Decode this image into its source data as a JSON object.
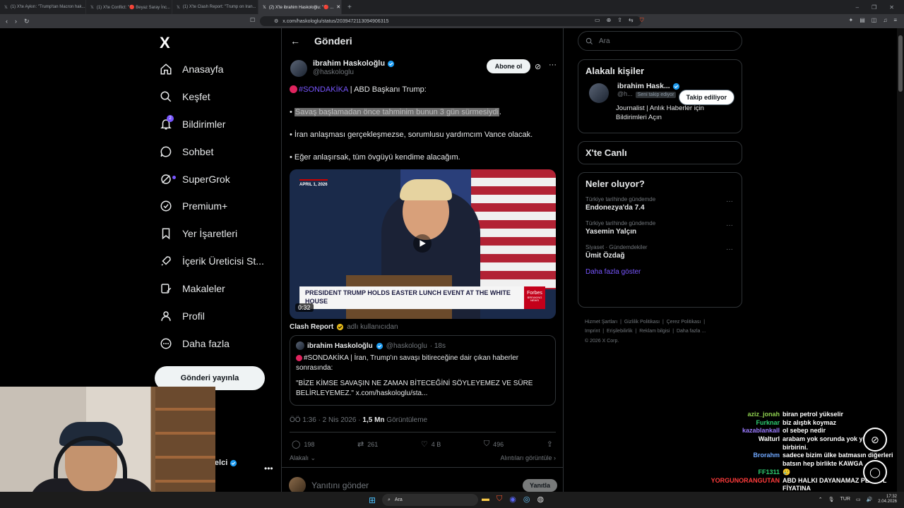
{
  "browser": {
    "tabs": [
      {
        "title": "(1) X'te Aykırı: \"Trump'tan Macron hak..."
      },
      {
        "title": "(1) X'te Conflict: \"🔴 Beyaz Saray İnc..."
      },
      {
        "title": "(1) X'te Clash Report: \"Trump on Iran..."
      },
      {
        "title": "(2) X'te ibrahim Haskoloğlu: \"🔴 ..."
      }
    ],
    "url": "x.com/haskologlu/status/2039472113094906315"
  },
  "nav": {
    "logo": "X",
    "items": [
      {
        "label": "Anasayfa"
      },
      {
        "label": "Keşfet"
      },
      {
        "label": "Bildirimler",
        "badge": "2"
      },
      {
        "label": "Sohbet"
      },
      {
        "label": "SuperGrok"
      },
      {
        "label": "Premium+"
      },
      {
        "label": "Yer İşaretleri"
      },
      {
        "label": "İçerik Üreticisi St..."
      },
      {
        "label": "Makaleler"
      },
      {
        "label": "Profil"
      },
      {
        "label": "Daha fazla"
      }
    ],
    "post_button": "Gönderi yayınla",
    "profile_name": "Telci",
    "profile_handle": "xi"
  },
  "main": {
    "header_title": "Gönderi",
    "author_name": "ibrahim Haskoloğlu",
    "author_handle": "@haskologlu",
    "subscribe_label": "Abone ol",
    "line1_hashtag": "#SONDAKİKA",
    "line1_rest": "| ABD Başkanı Trump:",
    "line2_bullet": "• ",
    "line2_highlight": "Savaş başlamadan önce tahminim bunun 3 gün sürmesiydi",
    "line2_end": ".",
    "line3": "• İran anlaşması gerçekleşmezse, sorumlusu yardımcım Vance olacak.",
    "line4": "• Eğer anlaşırsak, tüm övgüyü kendime alacağım.",
    "video": {
      "date": "APRIL 1, 2026",
      "caption": "PRESIDENT TRUMP HOLDS EASTER LUNCH EVENT AT THE WHITE HOUSE",
      "brand": "Forbes",
      "brand_sub": "BREAKING NEWS",
      "duration": "0:32"
    },
    "from_account": "Clash Report",
    "from_suffix": "adlı kullanıcıdan",
    "quote": {
      "name": "ibrahim Haskoloğlu",
      "handle": "@haskologlu",
      "time": "· 18s",
      "text1": "#SONDAKİKA | İran, Trump'ın savaşı bitireceğine dair çıkan haberler sonrasında:",
      "text2": "\"BİZE KİMSE SAVAŞIN NE ZAMAN BİTECEĞİNİ SÖYLEYEMEZ VE SÜRE BELİRLEYEMEZ.\" x.com/haskologlu/sta..."
    },
    "meta_time": "ÖÖ 1:36 · 2 Nis 2026 ·",
    "meta_views": "1,5 Mn",
    "meta_views_label": "Görüntüleme",
    "actions": {
      "replies": "198",
      "reposts": "261",
      "likes": "4 B",
      "bookmarks": "496"
    },
    "related_left": "Alakalı",
    "related_right": "Alıntıları görüntüle",
    "reply_placeholder": "Yanıtını gönder",
    "reply_button": "Yanıtla"
  },
  "right": {
    "search_placeholder": "Ara",
    "related_title": "Alakalı kişiler",
    "person_name": "ibrahim Hask...",
    "person_handle": "@h...",
    "person_tag": "Seni takip ediyor",
    "follow_label": "Takip ediliyor",
    "person_bio": "Journalist | Anlık Haberler için Bildirimleri Açın",
    "live_title": "X'te Canlı",
    "trends_title": "Neler oluyor?",
    "trends": [
      {
        "context": "Türkiye tarihinde gündemde",
        "title": "Endonezya'da 7.4"
      },
      {
        "context": "Türkiye tarihinde gündemde",
        "title": "Yasemin Yalçın"
      },
      {
        "context": "Siyaset · Gündemdekiler",
        "title": "Ümit Özdağ"
      }
    ],
    "show_more": "Daha fazla göster",
    "footer": [
      "Hizmet Şartları",
      "Gizlilik Politikası",
      "Çerez Politikası",
      "Imprint",
      "Erişilebilirlik",
      "Reklam bilgisi",
      "Daha fazla ...",
      "© 2026 X Corp."
    ]
  },
  "chat": [
    {
      "user": "aziz_jonah",
      "color": "#8fd14f",
      "msg": "biran petrol yükselir"
    },
    {
      "user": "Furknar",
      "color": "#2ecc71",
      "msg": "biz alıştık koymaz"
    },
    {
      "user": "kazablankall",
      "color": "#9b7bff",
      "msg": "ol sebep nedir"
    },
    {
      "user": "Walturl",
      "color": "#ffffff",
      "msg": "arabam yok sorunda yok yiyin birbirini."
    },
    {
      "user": "Brorahm",
      "color": "#6fa8ff",
      "msg": "sadece bizim ülke batmasın diğerleri batsın hep birlikte KAWGA"
    },
    {
      "user": "FF1311",
      "color": "#2ecc71",
      "msg": "🥲"
    },
    {
      "user": "YORGUNORANGUTAN",
      "color": "#ff3b3b",
      "msg": "ABD HALKI DAYANAMAZ PETROL FİYATINA"
    }
  ],
  "taskbar": {
    "search": "Ara",
    "lang": "TUR",
    "time": "17:32",
    "date": "2.04.2026"
  }
}
